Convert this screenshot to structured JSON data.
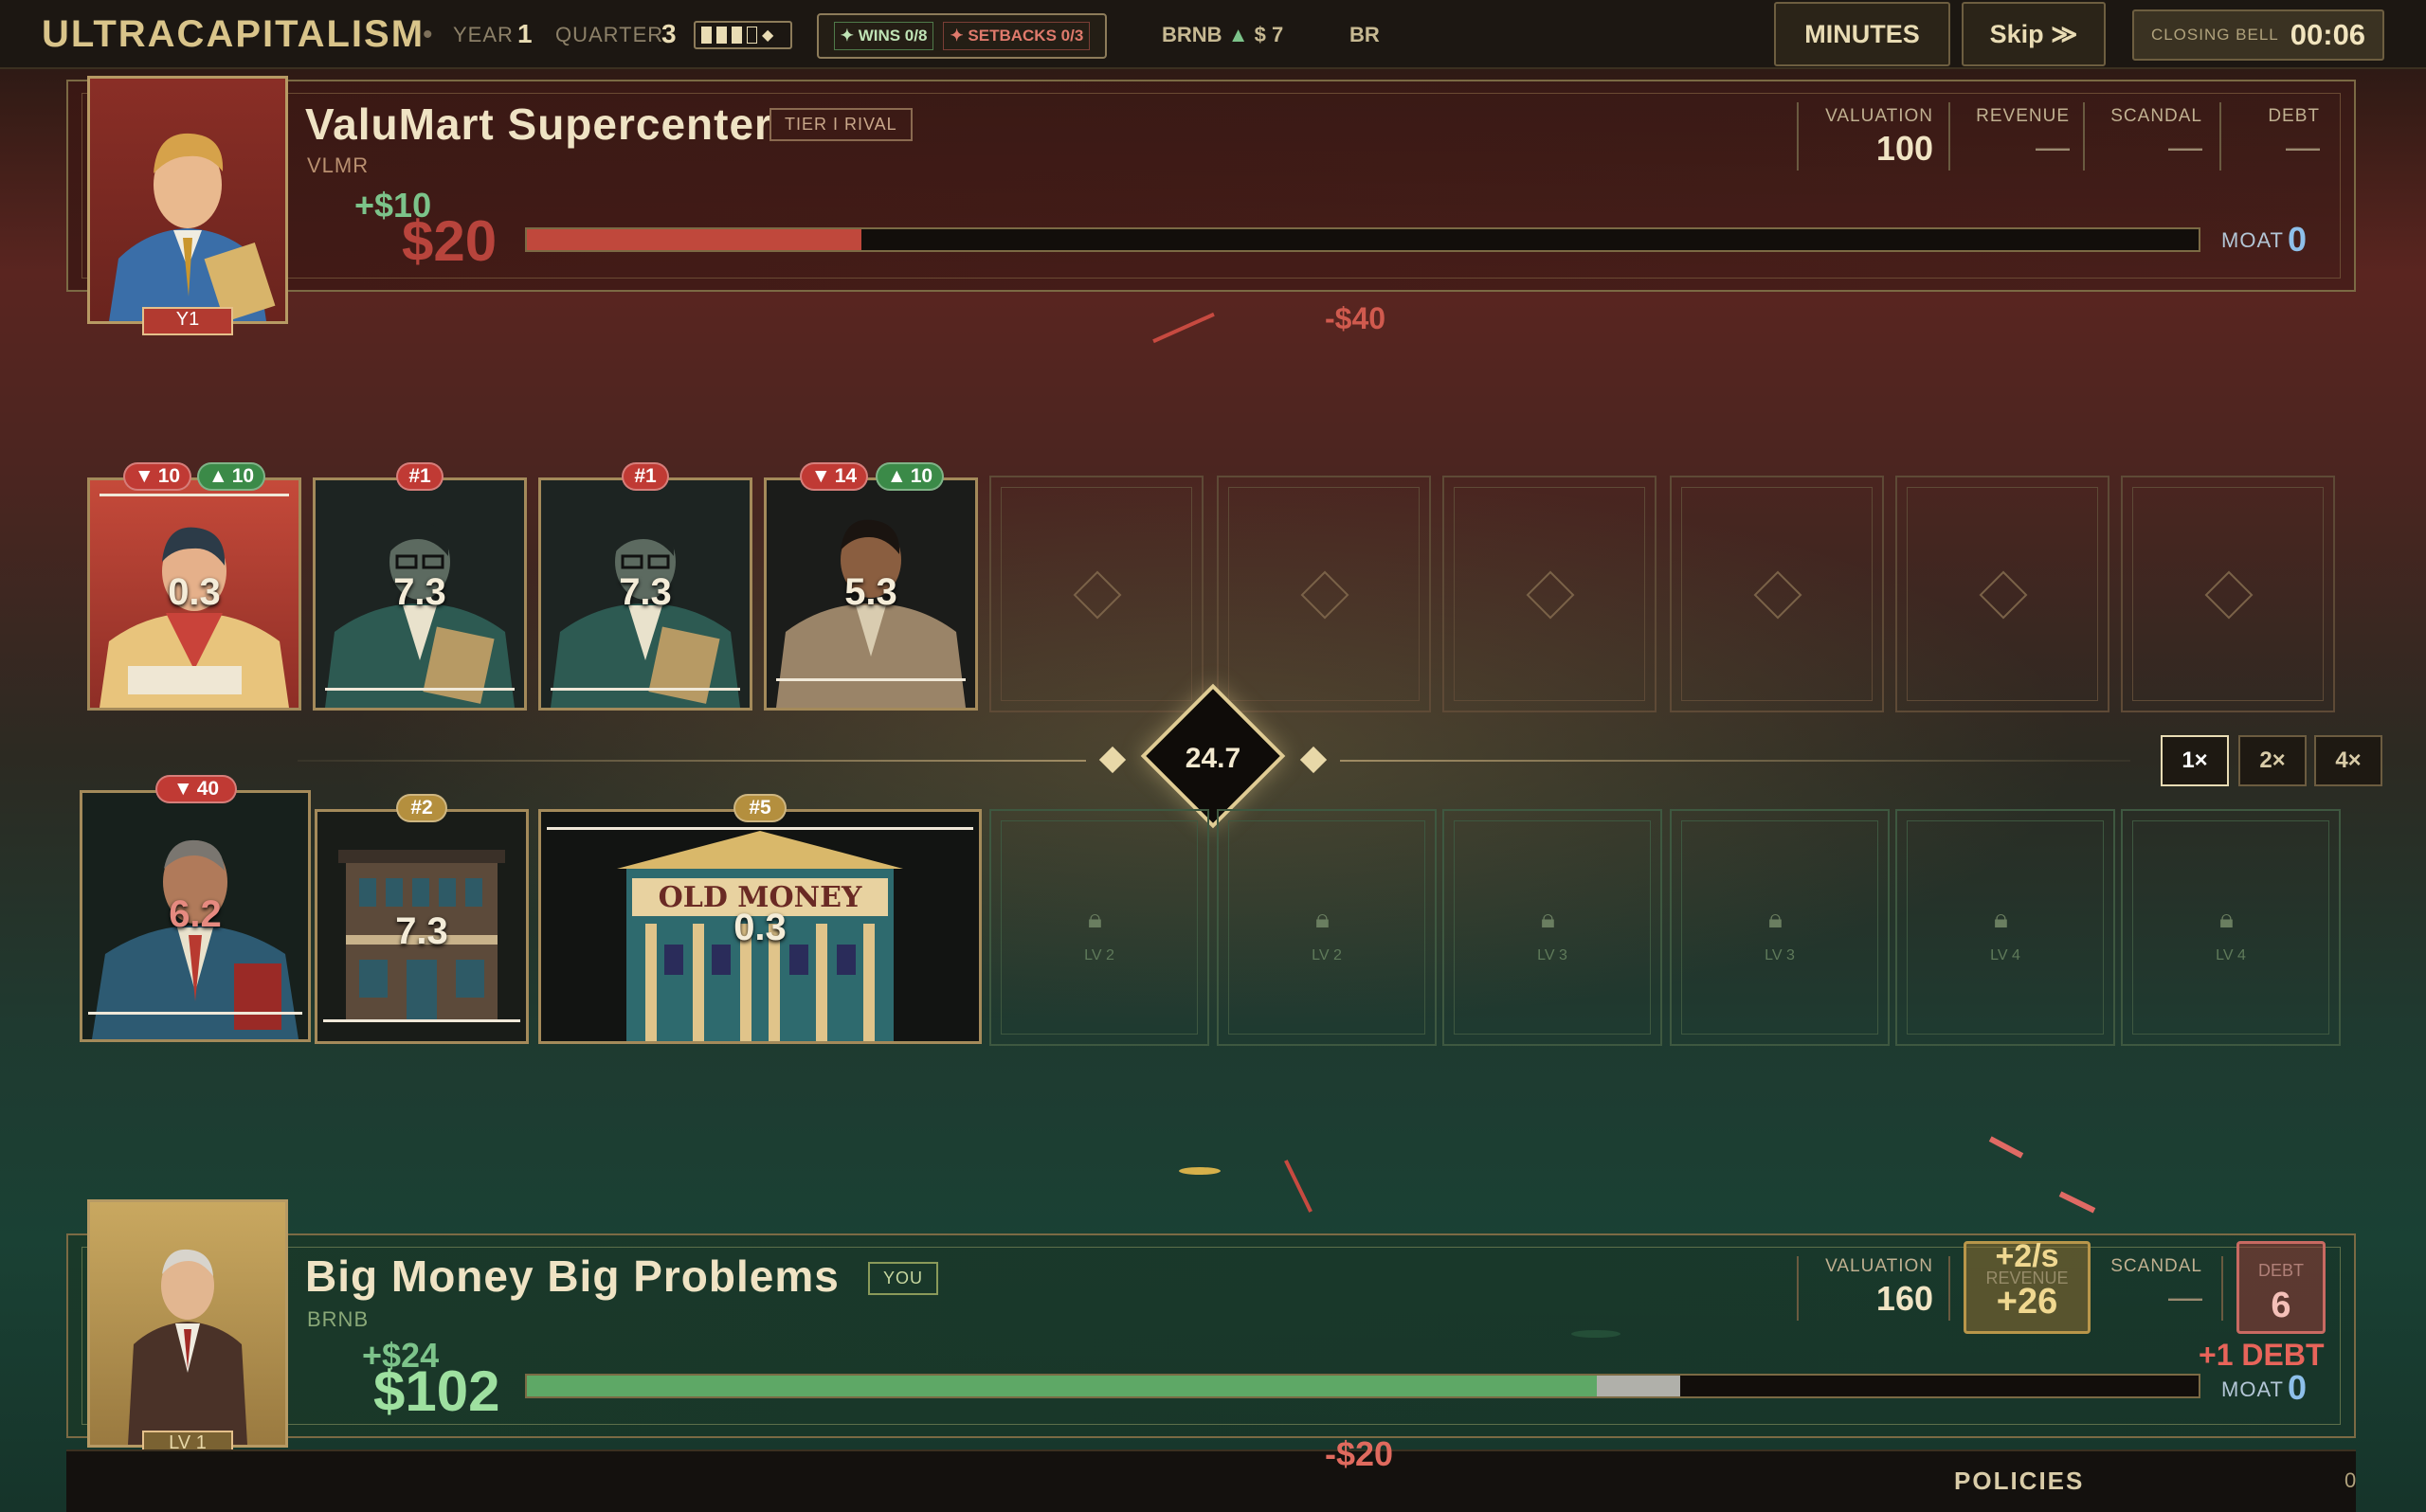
{
  "topbar": {
    "title": "ULTRACAPITALISM",
    "year_label": "YEAR",
    "year_value": "1",
    "quarter_label": "QUARTER",
    "quarter_value": "3",
    "quarter_progress": 0.75,
    "wins_label": "WINS 0/8",
    "setbacks_label": "SETBACKS 0/3",
    "ticker": "BRNB",
    "price": "$ 7",
    "region": "BR",
    "minutes_button": "MINUTES",
    "skip_button": "Skip ≫",
    "closing_bell_label": "CLOSING BELL",
    "closing_bell_time": "00:06"
  },
  "rival": {
    "name": "ValuMart Supercenter",
    "badge": "TIER I RIVAL",
    "ticker": "VLMR",
    "portrait_tag": "Y1",
    "cash_delta": "+$10",
    "cash": "$20",
    "cash_progress": 0.2,
    "valuation_label": "VALUATION",
    "valuation": "100",
    "revenue_label": "REVENUE",
    "revenue": "—",
    "scandal_label": "SCANDAL",
    "scandal": "—",
    "debt_label": "DEBT",
    "debt": "—",
    "moat_label": "MOAT",
    "moat": "0",
    "float_text": "-$40"
  },
  "rival_cards": [
    {
      "value": "0.3",
      "down": "10",
      "up": "10",
      "icon": "clerk-portrait"
    },
    {
      "value": "7.3",
      "tag": "#1",
      "icon": "compliance-officer-portrait"
    },
    {
      "value": "7.3",
      "tag": "#1",
      "icon": "compliance-officer-portrait"
    },
    {
      "value": "5.3",
      "down": "14",
      "up": "10",
      "icon": "manager-portrait"
    }
  ],
  "center": {
    "score": "24.7",
    "speeds": [
      "1×",
      "2×",
      "4×"
    ],
    "active_speed": "1×"
  },
  "my_cards": [
    {
      "value": "6.2",
      "down": "40",
      "icon": "executive-portrait"
    },
    {
      "value": "7.3",
      "tag": "#2",
      "icon": "storefront-building"
    },
    {
      "value": "0.3",
      "tag": "#5",
      "icon": "old-money-bank",
      "sign": "OLD MONEY"
    }
  ],
  "locked_slots": [
    "LV 2",
    "LV 2",
    "LV 3",
    "LV 3",
    "LV 4",
    "LV 4"
  ],
  "player": {
    "name": "Big Money Big Problems",
    "badge": "YOU",
    "ticker": "BRNB",
    "portrait_tag": "LV 1",
    "cash_delta": "+$24",
    "cash": "$102",
    "cash_progress": 0.64,
    "pending_progress": 0.05,
    "valuation_label": "VALUATION",
    "valuation": "160",
    "revenue_label": "REVENUE",
    "revenue_rate": "+2/s",
    "revenue": "+26",
    "scandal_label": "SCANDAL",
    "scandal": "—",
    "debt_label": "DEBT",
    "debt": "6",
    "debt_float": "+1 DEBT",
    "moat_label": "MOAT",
    "moat": "0",
    "float_text": "-$20"
  },
  "footer": {
    "policies_label": "POLICIES",
    "policies_count": "0"
  },
  "colors": {
    "accent": "#d9c48a",
    "loss": "#c03a34",
    "gain": "#3b8a48",
    "moat": "#8ec0ea"
  }
}
